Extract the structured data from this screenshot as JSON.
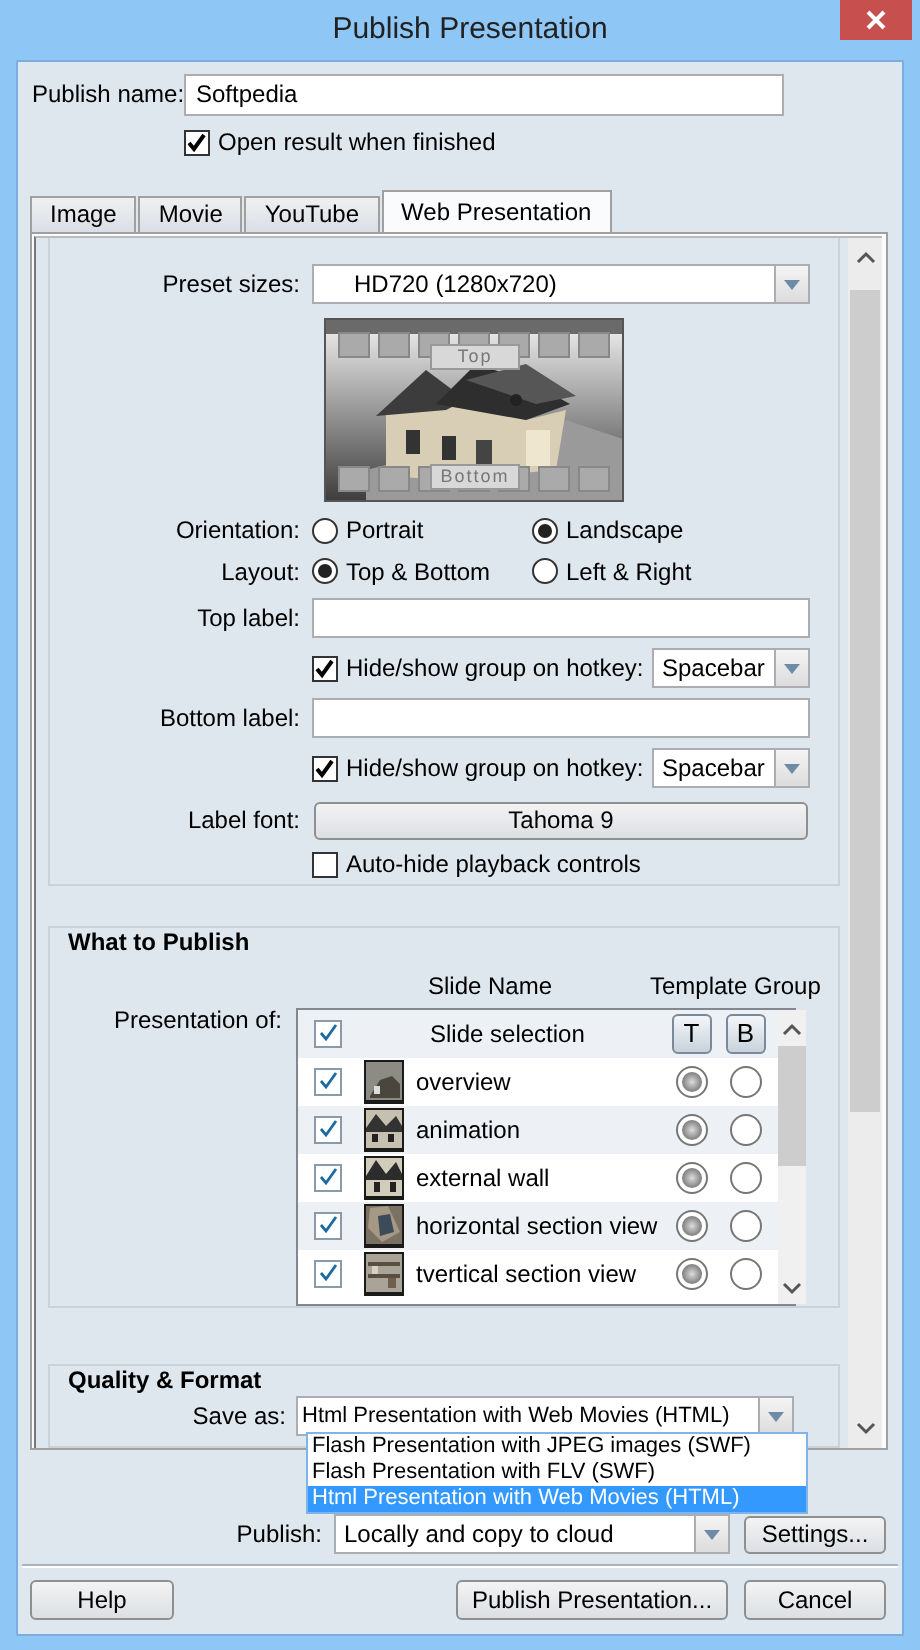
{
  "window": {
    "title": "Publish Presentation"
  },
  "publish_name": {
    "label": "Publish name:",
    "value": "Softpedia"
  },
  "open_result": {
    "label": "Open result when finished",
    "checked": true
  },
  "tabs": [
    {
      "label": "Image",
      "selected": false
    },
    {
      "label": "Movie",
      "selected": false
    },
    {
      "label": "YouTube",
      "selected": false
    },
    {
      "label": "Web Presentation",
      "selected": true
    }
  ],
  "preset": {
    "label": "Preset sizes:",
    "value": "HD720 (1280x720)"
  },
  "preview": {
    "top_label": "Top",
    "bottom_label": "Bottom"
  },
  "orientation": {
    "label": "Orientation:",
    "options": [
      {
        "label": "Portrait",
        "selected": false
      },
      {
        "label": "Landscape",
        "selected": true
      }
    ]
  },
  "layout": {
    "label": "Layout:",
    "options": [
      {
        "label": "Top & Bottom",
        "selected": true
      },
      {
        "label": "Left & Right",
        "selected": false
      }
    ]
  },
  "top_label": {
    "label": "Top label:"
  },
  "top_hotkey": {
    "label": "Hide/show group on hotkey:",
    "checked": true,
    "value": "Spacebar"
  },
  "bottom_label": {
    "label": "Bottom label:"
  },
  "bottom_hotkey": {
    "label": "Hide/show group on hotkey:",
    "checked": true,
    "value": "Spacebar"
  },
  "label_font": {
    "label": "Label font:",
    "button": "Tahoma 9"
  },
  "auto_hide": {
    "label": "Auto-hide playback controls",
    "checked": false
  },
  "what_to_publish": {
    "title": "What to Publish",
    "label": "Presentation of:",
    "columns": [
      "Slide Name",
      "Template Group"
    ],
    "header_row": {
      "label": "Slide selection",
      "checked": true,
      "buttons": [
        "T",
        "B"
      ]
    },
    "slides": [
      {
        "name": "overview",
        "checked": true,
        "groups": [
          {
            "selected": true
          },
          {
            "selected": false
          }
        ]
      },
      {
        "name": "animation",
        "checked": true,
        "groups": [
          {
            "selected": true
          },
          {
            "selected": false
          }
        ]
      },
      {
        "name": "external wall",
        "checked": true,
        "groups": [
          {
            "selected": true
          },
          {
            "selected": false
          }
        ]
      },
      {
        "name": "horizontal section view",
        "checked": true,
        "groups": [
          {
            "selected": true
          },
          {
            "selected": false
          }
        ]
      },
      {
        "name": "tvertical section view",
        "checked": true,
        "groups": [
          {
            "selected": true
          },
          {
            "selected": false
          }
        ]
      }
    ]
  },
  "quality": {
    "title": "Quality & Format",
    "save_as_label": "Save as:",
    "save_as_value": "Html Presentation with Web Movies (HTML)",
    "dropdown": [
      {
        "label": "Flash Presentation with JPEG images (SWF)",
        "selected": false
      },
      {
        "label": "Flash Presentation with FLV (SWF)",
        "selected": false
      },
      {
        "label": "Html Presentation with Web Movies (HTML)",
        "selected": true
      }
    ]
  },
  "publish": {
    "label": "Publish:",
    "value": "Locally and copy to cloud",
    "settings_button": "Settings..."
  },
  "buttons": [
    {
      "label": "Help"
    },
    {
      "label": "Publish Presentation..."
    },
    {
      "label": "Cancel"
    }
  ]
}
